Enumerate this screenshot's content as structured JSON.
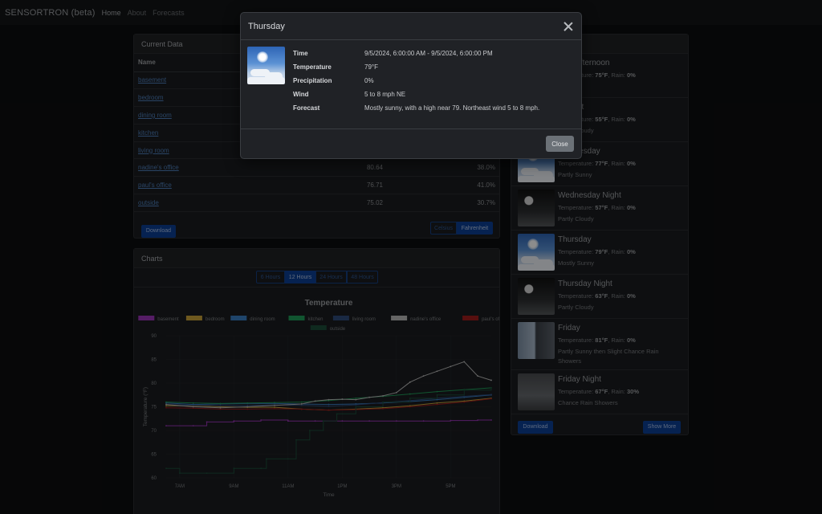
{
  "nav": {
    "brand": "SENSORTRON (beta)",
    "links": [
      "Home",
      "About",
      "Forecasts"
    ]
  },
  "current": {
    "title": "Current Data",
    "col_name": "Name",
    "rows": [
      {
        "name": "basement",
        "temp": "",
        "humidity": ""
      },
      {
        "name": "bedroom",
        "temp": "",
        "humidity": ""
      },
      {
        "name": "dining room",
        "temp": "",
        "humidity": ""
      },
      {
        "name": "kitchen",
        "temp": "",
        "humidity": ""
      },
      {
        "name": "living room",
        "temp": "",
        "humidity": ""
      },
      {
        "name": "nadine's office",
        "temp": "80.64",
        "humidity": "38.0%"
      },
      {
        "name": "paul's office",
        "temp": "76.71",
        "humidity": "41.0%"
      },
      {
        "name": "outside",
        "temp": "75.02",
        "humidity": "30.7%"
      }
    ],
    "download": "Download",
    "unit_celsius": "Celsius",
    "unit_fahrenheit": "Fahrenheit"
  },
  "charts": {
    "title": "Charts",
    "ranges": [
      "6 Hours",
      "12 Hours",
      "24 Hours",
      "48 Hours"
    ],
    "active_range": "12 Hours"
  },
  "chart_data": {
    "type": "line",
    "title": "Temperature",
    "xlabel": "Time",
    "ylabel": "Temperature (°F)",
    "ylim": [
      60,
      90
    ],
    "yticks": [
      60,
      65,
      70,
      75,
      80,
      85,
      90
    ],
    "xticks": [
      "7AM",
      "9AM",
      "11AM",
      "1PM",
      "3PM",
      "5PM"
    ],
    "xlim": [
      6.5,
      18.5
    ],
    "legend": "top",
    "series": [
      {
        "name": "basement",
        "color": "#9b35b8",
        "x": [
          6.5,
          7.5,
          8,
          9,
          10,
          11,
          12,
          13,
          14,
          15,
          16,
          17,
          18,
          18.5
        ],
        "y": [
          71,
          71,
          71.8,
          72,
          72.2,
          72,
          72,
          72,
          72,
          72,
          72,
          72.1,
          72.2,
          72.2
        ]
      },
      {
        "name": "bedroom",
        "color": "#c8a23a",
        "x": [
          6.5,
          7.5,
          8.5,
          9.5,
          10.5,
          11.5,
          12.5,
          13.5,
          14.5,
          15.5,
          16.5,
          17.5,
          18.5
        ],
        "y": [
          75.2,
          75.2,
          75.0,
          74.9,
          74.9,
          74.5,
          74.3,
          74.5,
          74.8,
          75.2,
          75.8,
          76.2,
          76.8
        ]
      },
      {
        "name": "dining room",
        "color": "#3a7fc3",
        "x": [
          6.5,
          7.5,
          8.5,
          9.5,
          10.5,
          11.5,
          12.5,
          13.5,
          14.5,
          15.5,
          16.5,
          17.5,
          18.5
        ],
        "y": [
          75.8,
          75.5,
          75.6,
          75.7,
          75.7,
          75.6,
          75.5,
          75.6,
          75.8,
          76.1,
          76.5,
          77.0,
          77.5
        ]
      },
      {
        "name": "kitchen",
        "color": "#1f9b58",
        "x": [
          6.5,
          7.5,
          8.5,
          9.5,
          10.5,
          11.5,
          12.5,
          13.5,
          14.5,
          15.5,
          16.5,
          17.5,
          18.5
        ],
        "y": [
          76.0,
          75.8,
          75.7,
          75.8,
          75.9,
          76.0,
          76.3,
          76.8,
          77.2,
          77.7,
          78.2,
          78.6,
          79.0
        ]
      },
      {
        "name": "living room",
        "color": "#2e4c7a",
        "x": [
          6.5,
          7.5,
          8.5,
          9.5,
          10.5,
          11.5,
          12.5,
          13.5,
          14.5,
          15.5,
          16.5,
          17.5,
          18.5
        ],
        "y": [
          75.5,
          75.3,
          75.2,
          75.3,
          75.4,
          75.3,
          75.1,
          75.4,
          75.9,
          76.3,
          76.8,
          77.2,
          77.6
        ]
      },
      {
        "name": "nadine's office",
        "color": "#b9b9b9",
        "x": [
          6.5,
          7.5,
          8.5,
          9.5,
          10.5,
          11.5,
          12,
          12.5,
          13,
          13.5,
          14,
          14.5,
          15,
          15.5,
          16,
          16.5,
          17,
          17.5,
          18,
          18.5
        ],
        "y": [
          75.5,
          75.0,
          74.8,
          75.0,
          75.3,
          75.6,
          76.2,
          76.5,
          76.6,
          76.5,
          77.0,
          77.3,
          78.0,
          80.2,
          81.5,
          82.5,
          83.5,
          84.5,
          81.5,
          80.6
        ]
      },
      {
        "name": "paul's office",
        "color": "#9e1c1c",
        "x": [
          6.5,
          7.5,
          8.5,
          9.5,
          10.5,
          11.5,
          12.5,
          13.5,
          14.5,
          15.5,
          16.5,
          17.5,
          18.5
        ],
        "y": [
          74.8,
          74.7,
          74.5,
          74.5,
          74.6,
          74.5,
          74.3,
          74.4,
          74.6,
          75.0,
          75.5,
          76.0,
          76.7
        ]
      },
      {
        "name": "outside",
        "color": "#1d4d3a",
        "x": [
          6.5,
          7,
          8,
          9,
          10,
          10.2,
          11,
          11.3,
          11.8,
          12.3,
          12.8,
          13.5,
          14.5,
          15.5,
          16.5,
          17.5,
          18.5
        ],
        "y": [
          62,
          61,
          61,
          62,
          62,
          64,
          64,
          68,
          70,
          72,
          73.5,
          75,
          76,
          76.8,
          77.5,
          78.5,
          79
        ]
      }
    ]
  },
  "forecast": {
    "items": [
      {
        "name": "This Afternoon",
        "temp": "75°F",
        "rain": "0%",
        "desc": "",
        "thumb": "sky"
      },
      {
        "name": "Tonight",
        "temp": "55°F",
        "rain": "0%",
        "desc": "Partly Cloudy",
        "thumb": "night"
      },
      {
        "name": "Wednesday",
        "temp": "77°F",
        "rain": "0%",
        "desc": "Partly Sunny",
        "thumb": "sky"
      },
      {
        "name": "Wednesday Night",
        "temp": "57°F",
        "rain": "0%",
        "desc": "Partly Cloudy",
        "thumb": "night"
      },
      {
        "name": "Thursday",
        "temp": "79°F",
        "rain": "0%",
        "desc": "Mostly Sunny",
        "thumb": "sky"
      },
      {
        "name": "Thursday Night",
        "temp": "63°F",
        "rain": "0%",
        "desc": "Partly Cloudy",
        "thumb": "night"
      },
      {
        "name": "Friday",
        "temp": "81°F",
        "rain": "0%",
        "desc": "Partly Sunny then Slight Chance Rain Showers",
        "thumb": "rain"
      },
      {
        "name": "Friday Night",
        "temp": "67°F",
        "rain": "30%",
        "desc": "Chance Rain Showers",
        "thumb": "gray"
      }
    ],
    "temp_label": "Temperature: ",
    "rain_label": ", Rain: ",
    "download": "Download",
    "show_more": "Show More"
  },
  "modal": {
    "title": "Thursday",
    "fields": [
      {
        "label": "Time",
        "value": "9/5/2024, 6:00:00 AM - 9/5/2024, 6:00:00 PM"
      },
      {
        "label": "Temperature",
        "value": "79°F"
      },
      {
        "label": "Precipitation",
        "value": "0%"
      },
      {
        "label": "Wind",
        "value": "5 to 8 mph NE"
      },
      {
        "label": "Forecast",
        "value": "Mostly sunny, with a high near 79. Northeast wind 5 to 8 mph."
      }
    ],
    "close_button": "Close"
  }
}
